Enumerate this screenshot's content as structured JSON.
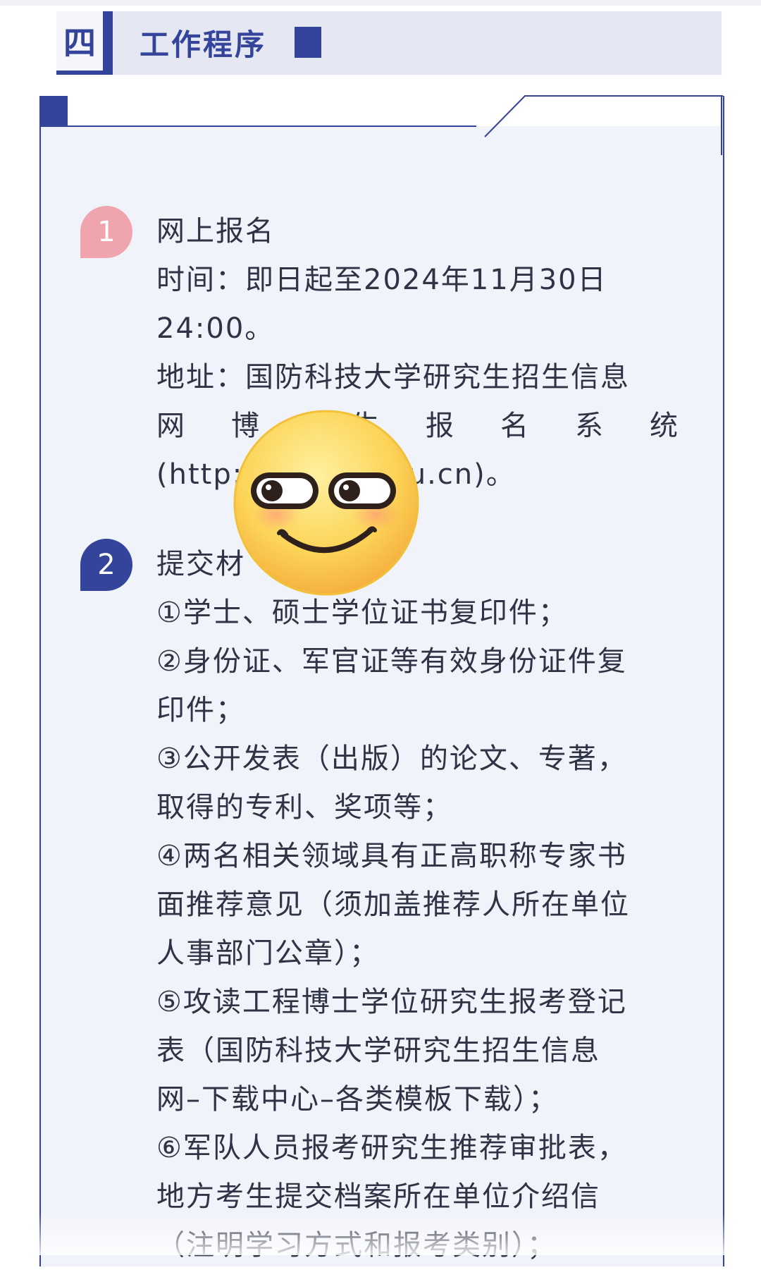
{
  "header": {
    "number": "四",
    "title": "工作程序"
  },
  "steps": [
    {
      "badge": "1",
      "heading": "网上报名",
      "lines": [
        "时间：即日起至2024年11月30日",
        "24:00。",
        "地址：国防科技大学研究生招生信息",
        "网 博  生 报 名 系 统",
        "(http:          t.edu.cn)。"
      ]
    },
    {
      "badge": "2",
      "heading": "提交材",
      "lines": [
        "①学士、硕士学位证书复印件；",
        "②身份证、军官证等有效身份证件复",
        "印件；",
        "③公开发表（出版）的论文、专著，",
        "取得的专利、奖项等；",
        "④两名相关领域具有正高职称专家书",
        "面推荐意见（须加盖推荐人所在单位",
        "人事部门公章）；",
        "⑤攻读工程博士学位研究生报考登记",
        "表（国防科技大学研究生招生信息",
        "网–下载中心–各类模板下载）；",
        "⑥军队人员报考研究生推荐审批表，",
        "地方考生提交档案所在单位介绍信",
        "（注明学习方式和报考类别）；"
      ]
    }
  ],
  "row4_words": [
    "网",
    "博",
    "",
    "生",
    "报",
    "名",
    "系",
    "统"
  ],
  "sticker": {
    "icon": "smirk-emoji-icon"
  },
  "colors": {
    "accent": "#34449a",
    "pink": "#f0a5ae",
    "card_bg": "#f1f3fa"
  }
}
